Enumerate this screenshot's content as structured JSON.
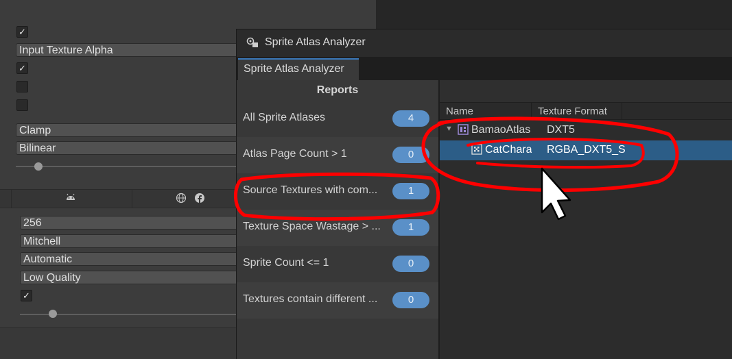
{
  "inspector": {
    "checkbox_mark": "✓",
    "alpha_source": "Input Texture Alpha",
    "wrap_mode": "Clamp",
    "filter_mode": "Bilinear",
    "max_size": "256",
    "resize_algorithm": "Mitchell",
    "format": "Automatic",
    "compression": "Low Quality",
    "platform_tabs": {
      "android_icon": "android-icon",
      "web_icon": "globe-icon",
      "facebook_icon": "facebook-icon"
    }
  },
  "window": {
    "title": "Sprite Atlas Analyzer",
    "tab_label": "Sprite Atlas Analyzer"
  },
  "reports": {
    "header": "Reports",
    "items": [
      {
        "label": "All Sprite Atlases",
        "count": "4"
      },
      {
        "label": "Atlas Page Count > 1",
        "count": "0"
      },
      {
        "label": "Source Textures with com...",
        "count": "1"
      },
      {
        "label": "Texture Space Wastage > ...",
        "count": "1"
      },
      {
        "label": "Sprite Count <= 1",
        "count": "0"
      },
      {
        "label": "Textures contain different ...",
        "count": "0"
      }
    ]
  },
  "results": {
    "columns": {
      "name": "Name",
      "texture_format": "Texture Format"
    },
    "rows": [
      {
        "name": "BamaoAtlas",
        "format": "DXT5"
      },
      {
        "name": "CatChara",
        "format": "RGBA_DXT5_S"
      }
    ]
  },
  "colors": {
    "accent": "#3a79bb",
    "badge": "#5a90c8",
    "selection": "#2c5d87",
    "annotation": "#ff0000"
  }
}
